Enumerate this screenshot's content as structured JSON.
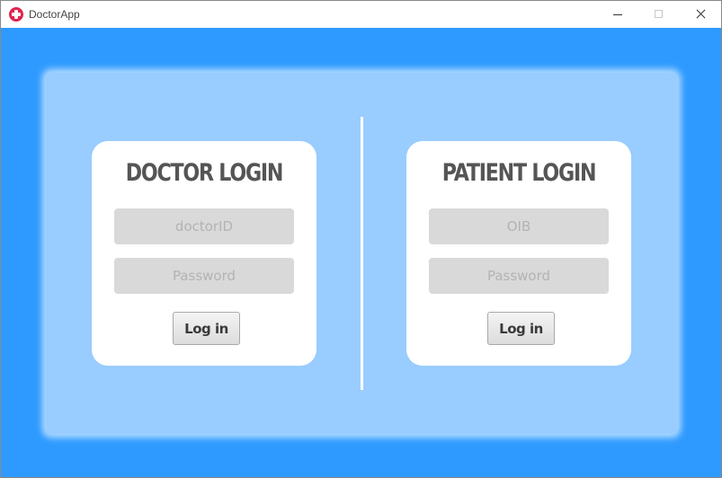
{
  "window": {
    "title": "DoctorApp",
    "icon": "medical-cross-icon",
    "controls": [
      "minimize-icon",
      "maximize-icon",
      "close-icon"
    ]
  },
  "colors": {
    "background": "#2e9aff",
    "panel": "#99ccff",
    "card": "#ffffff",
    "field": "#d9d9d9",
    "title_text": "#555555",
    "app_icon": "#e0234e"
  },
  "doctor_login": {
    "title": "DOCTOR LOGIN",
    "id_placeholder": "doctorID",
    "password_placeholder": "Password",
    "button_label": "Log in"
  },
  "patient_login": {
    "title": "PATIENT LOGIN",
    "id_placeholder": "OIB",
    "password_placeholder": "Password",
    "button_label": "Log in"
  }
}
